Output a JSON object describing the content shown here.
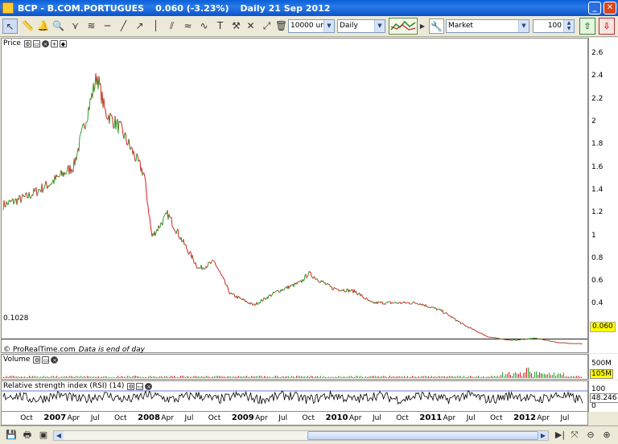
{
  "window": {
    "title_symbol": "BCP - B.COM.PORTUGUES",
    "title_price": "0.060 (-3.23%)",
    "title_period": "Daily",
    "title_date": "21 Sep 2012"
  },
  "toolbar": {
    "units_value": "10000 units",
    "timeframe_value": "Daily",
    "order_type_value": "Market",
    "quantity_value": "100"
  },
  "tools": [
    "pointer-icon",
    "ruler-icon",
    "alarm-icon",
    "magnifier-icon",
    "fan-icon",
    "fibonacci-icon",
    "horizontal-line-icon",
    "trend-line-icon",
    "ray-icon",
    "vertical-line-icon",
    "channel-icon",
    "regression-icon",
    "polyline-icon",
    "text-icon",
    "arrow-icon",
    "hammer-icon",
    "cross-icon",
    "diagonal-icon",
    "trash-icon"
  ],
  "price_panel": {
    "label": "Price",
    "reference_level_label": "0.1028",
    "last_value_label": "0.060",
    "copyright": "© ProRealTime.com",
    "footer_note": "Data is end of day",
    "y_ticks": [
      "2.6",
      "2.4",
      "2.2",
      "2",
      "1.8",
      "1.6",
      "1.4",
      "1.2",
      "1",
      "0.8",
      "0.6",
      "0.4",
      "0.2"
    ]
  },
  "volume_panel": {
    "label": "Volume",
    "y_tick": "500M",
    "last_value_label": "105M"
  },
  "rsi_panel": {
    "label": "Relative strength index (RSI) (14)",
    "y_ticks": [
      "100",
      "0"
    ],
    "last_value_label": "48.246"
  },
  "x_axis_labels": [
    {
      "text": "Oct",
      "year": false
    },
    {
      "text": "2007",
      "year": true
    },
    {
      "text": "Apr",
      "year": false
    },
    {
      "text": "Jul",
      "year": false
    },
    {
      "text": "Oct",
      "year": false
    },
    {
      "text": "2008",
      "year": true
    },
    {
      "text": "Apr",
      "year": false
    },
    {
      "text": "Jul",
      "year": false
    },
    {
      "text": "Oct",
      "year": false
    },
    {
      "text": "2009",
      "year": true
    },
    {
      "text": "Apr",
      "year": false
    },
    {
      "text": "Jul",
      "year": false
    },
    {
      "text": "Oct",
      "year": false
    },
    {
      "text": "2010",
      "year": true
    },
    {
      "text": "Apr",
      "year": false
    },
    {
      "text": "Jul",
      "year": false
    },
    {
      "text": "Oct",
      "year": false
    },
    {
      "text": "2011",
      "year": true
    },
    {
      "text": "Apr",
      "year": false
    },
    {
      "text": "Jul",
      "year": false
    },
    {
      "text": "Oct",
      "year": false
    },
    {
      "text": "2012",
      "year": true
    },
    {
      "text": "Apr",
      "year": false
    },
    {
      "text": "Jul",
      "year": false
    }
  ],
  "colors": {
    "up": "#2aa22a",
    "down": "#d22020",
    "rsi": "#000000",
    "volume": "#d22020",
    "badge": "#ffff00"
  },
  "chart_data": [
    {
      "type": "line",
      "title": "Price",
      "x": [
        "2006-07",
        "2006-10",
        "2007-01",
        "2007-04",
        "2007-07",
        "2007-08",
        "2007-10",
        "2008-01",
        "2008-02",
        "2008-04",
        "2008-06",
        "2008-08",
        "2008-10",
        "2008-12",
        "2009-03",
        "2009-06",
        "2009-09",
        "2009-10",
        "2010-01",
        "2010-04",
        "2010-06",
        "2010-09",
        "2010-12",
        "2011-03",
        "2011-06",
        "2011-09",
        "2011-12",
        "2012-03",
        "2012-06",
        "2012-09"
      ],
      "values": [
        1.28,
        1.35,
        1.47,
        1.62,
        2.42,
        2.1,
        1.95,
        1.55,
        1.0,
        1.2,
        0.95,
        0.72,
        0.78,
        0.5,
        0.4,
        0.52,
        0.6,
        0.68,
        0.55,
        0.52,
        0.42,
        0.42,
        0.42,
        0.35,
        0.22,
        0.12,
        0.09,
        0.11,
        0.07,
        0.06
      ],
      "ylim": [
        0,
        2.7
      ],
      "reference_line": 0.1028,
      "last": 0.06
    },
    {
      "type": "bar",
      "title": "Volume",
      "ylim": [
        0,
        500000000
      ],
      "last": 105000000
    },
    {
      "type": "line",
      "title": "Relative strength index (RSI) (14)",
      "ylim": [
        0,
        100
      ],
      "last": 48.246
    }
  ]
}
